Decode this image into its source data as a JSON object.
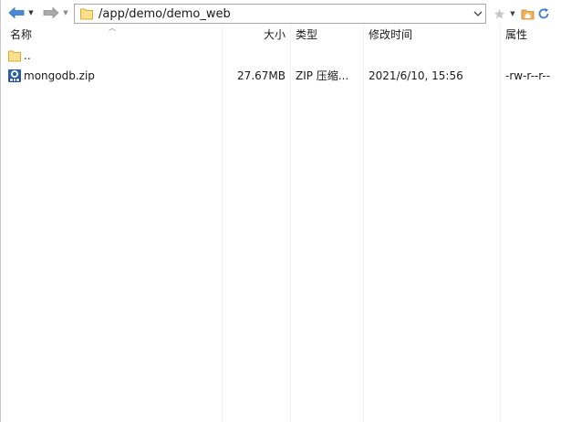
{
  "toolbar": {
    "address_path": "/app/demo/demo_web",
    "back_icon": "back-arrow-icon",
    "forward_icon": "forward-arrow-icon",
    "accent": "#3b7fd3"
  },
  "columns": {
    "name": "名称",
    "size": "大小",
    "type": "类型",
    "modified": "修改时间",
    "attributes": "属性"
  },
  "files": [
    {
      "icon": "folder-icon",
      "name": "..",
      "size": "",
      "type": "",
      "modified": "",
      "attributes": ""
    },
    {
      "icon": "zip-file-icon",
      "name": "mongodb.zip",
      "size": "27.67MB",
      "type": "ZIP 压缩...",
      "modified": "2021/6/10, 15:56",
      "attributes": "-rw-r--r--"
    }
  ]
}
